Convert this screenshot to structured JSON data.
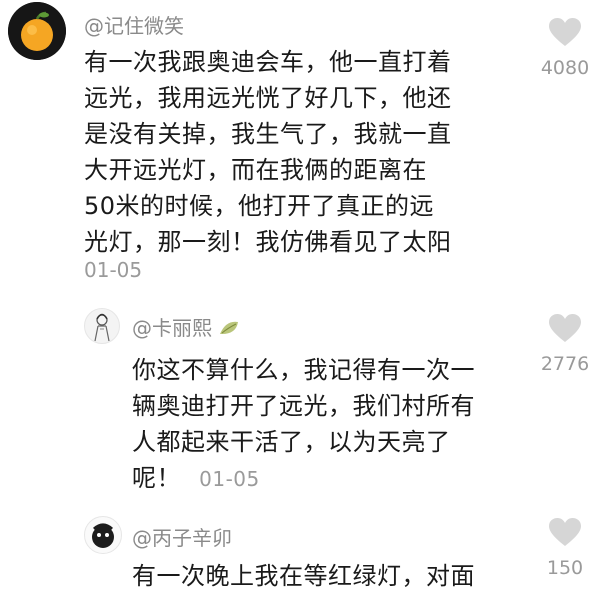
{
  "comments": [
    {
      "username": "@记住微笑",
      "avatar": "orange-fruit-avatar",
      "lines": [
        "有一次我跟奥迪会车，他一直打着",
        "远光，我用远光恍了好几下，他还",
        "是没有关掉，我生气了，我就一直",
        "大开远光灯，而在我俩的距离在",
        "50米的时候，他打开了真正的远",
        "光灯，那一刻！我仿佛看见了太阳"
      ],
      "date": "01-05",
      "likes": "4080"
    },
    {
      "username": "@卡丽熙",
      "avatar": "girl-sketch-avatar",
      "lines": [
        "你这不算什么，我记得有一次一",
        "辆奥迪打开了远光，我们村所有",
        "人都起来干活了，以为天亮了",
        "呢！"
      ],
      "date": "01-05",
      "likes": "2776"
    },
    {
      "username": "@丙子辛卯",
      "avatar": "dark-cartoon-avatar",
      "lines": [
        "有一次晚上我在等红绿灯，对面"
      ],
      "likes": "150"
    }
  ],
  "colors": {
    "like_icon": "#d6d6d6",
    "username": "#8a8a8a",
    "orange": "#f5a623"
  }
}
